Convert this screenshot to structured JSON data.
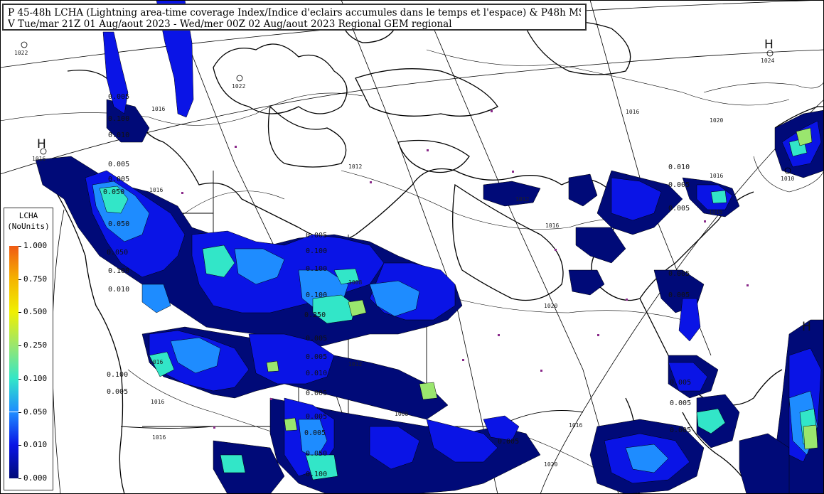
{
  "title": {
    "line1": "P 45-48h LCHA (Lightning area-time coverage Index/Indice d'eclairs accumules dans le temps et l'espace)  & P48h MSLP/PNM",
    "line2": "V Tue/mar 21Z 01 Aug/aout 2023 - Wed/mer 00Z 02 Aug/aout 2023  Regional GEM regional"
  },
  "legend": {
    "title": "LCHA",
    "units": "(NoUnits)",
    "levels": [
      "1.000",
      "0.750",
      "0.500",
      "0.250",
      "0.100",
      "0.050",
      "0.010",
      "0.000"
    ],
    "colors": [
      "#f05a14",
      "#f5b400",
      "#f0f000",
      "#9ae66e",
      "#32e6c8",
      "#1e8cff",
      "#0a14e6",
      "#000a78"
    ]
  },
  "colors": {
    "land": "#ffffff",
    "coast": "#000000",
    "isobar": "#000000",
    "darkest": "#000a78",
    "blue": "#0a14e6",
    "mid_blue": "#1e8cff",
    "cyan": "#32e6c8",
    "green": "#9ae66e"
  },
  "pressure_centers": [
    {
      "type": "H",
      "value": "1022"
    },
    {
      "type": "H",
      "value": "1024"
    },
    {
      "type": "L",
      "value": "1022"
    },
    {
      "type": "H",
      "value": ""
    },
    {
      "type": "L",
      "value": "1010"
    },
    {
      "type": "H",
      "value": ""
    }
  ],
  "isobar_labels": [
    "1016",
    "1012",
    "1016",
    "1012",
    "1016",
    "1020",
    "1016",
    "1008",
    "1016",
    "1020",
    "1016",
    "1016",
    "1012",
    "1008",
    "1016",
    "1020",
    "1016",
    "1016",
    "1016"
  ],
  "value_labels": [
    "0.005",
    "0.100",
    "0.010",
    "0.005",
    "0.050",
    "0.050",
    "0.050",
    "0.100",
    "0.005",
    "0.100",
    "0.100",
    "0.100",
    "0.250",
    "0.005",
    "0.005",
    "0.010",
    "0.005",
    "0.005",
    "0.005",
    "0.050",
    "0.100",
    "0.100",
    "0.005",
    "0.010",
    "0.005",
    "0.005",
    "0.005",
    "0.005",
    "0.005",
    "0.005",
    "0.005",
    "0.010",
    "0.005",
    "0.005"
  ]
}
